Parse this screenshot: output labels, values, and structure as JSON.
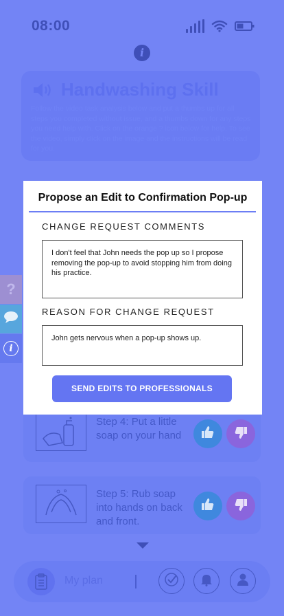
{
  "status_bar": {
    "time": "08:00"
  },
  "header": {
    "info_glyph": "i",
    "title": "Handwashing Skill",
    "instructions": "Follow the video task analysis below and put a thumbs up for all steps you completed without issue, and a thumbs down for any steps you need help with. Click on the orange ? icon below for help. To see the video, simply click on the image and the instructions will be read for you."
  },
  "side_tabs": {
    "help_glyph": "?",
    "info_glyph": "i"
  },
  "steps": [
    {
      "text": "Step 4: Put a little soap on your hand"
    },
    {
      "text": "Step 5: Rub soap into hands on back and front."
    }
  ],
  "bottom_nav": {
    "plan_label": "My plan"
  },
  "modal": {
    "title": "Propose an Edit to Confirmation Pop-up",
    "comments_label": "CHANGE REQUEST COMMENTS",
    "comments_value": "I don't feel that John needs the pop up so I propose removing the pop-up to avoid stopping him from doing his practice.",
    "reason_label": "REASON FOR CHANGE REQUEST",
    "reason_value": "John gets nervous when a pop-up shows up.",
    "send_button": "SEND EDITS TO PROFESSIONALS"
  },
  "colors": {
    "overlay": "#7384f5",
    "accent": "#6475f2",
    "thumbs_up": "#3f88de",
    "thumbs_down": "#8a65dd"
  }
}
